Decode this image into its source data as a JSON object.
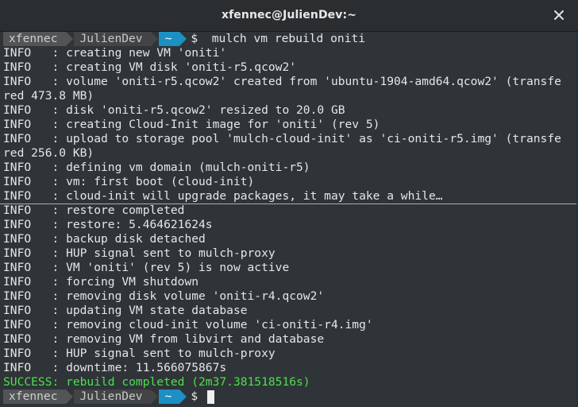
{
  "window": {
    "title": "xfennec@JulienDev:~"
  },
  "prompt_top": {
    "user": "xfennec",
    "host": "JulienDev",
    "dir": "~",
    "symbol": "$",
    "command": "  mulch vm rebuild oniti"
  },
  "output_upper": [
    "INFO   : creating new VM 'oniti'",
    "INFO   : creating VM disk 'oniti-r5.qcow2'",
    "INFO   : volume 'oniti-r5.qcow2' created from 'ubuntu-1904-amd64.qcow2' (transfe",
    "red 473.8 MB)",
    "INFO   : disk 'oniti-r5.qcow2' resized to 20.0 GB",
    "INFO   : creating Cloud-Init image for 'oniti' (rev 5)",
    "INFO   : upload to storage pool 'mulch-cloud-init' as 'ci-oniti-r5.img' (transfe",
    "red 256.0 KB)",
    "INFO   : defining vm domain (mulch-oniti-r5)",
    "INFO   : vm: first boot (cloud-init)",
    "INFO   : cloud-init will upgrade packages, it may take a while…"
  ],
  "output_lower": [
    "INFO   : restore completed",
    "INFO   : restore: 5.464621624s",
    "INFO   : backup disk detached",
    "INFO   : HUP signal sent to mulch-proxy",
    "INFO   : VM 'oniti' (rev 5) is now active",
    "INFO   : forcing VM shutdown",
    "INFO   : removing disk volume 'oniti-r4.qcow2'",
    "INFO   : updating VM state database",
    "INFO   : removing cloud-init volume 'ci-oniti-r4.img'",
    "INFO   : removing VM from libvirt and database",
    "INFO   : HUP signal sent to mulch-proxy",
    "INFO   : downtime: 11.566075867s"
  ],
  "success_line": "SUCCESS: rebuild completed (2m37.381518516s)",
  "prompt_bottom": {
    "user": "xfennec",
    "host": "JulienDev",
    "dir": "~",
    "symbol": "$"
  },
  "icons": {
    "close": "close-icon"
  },
  "colors": {
    "prompt_dir_bg": "#1c8fc3",
    "success_text": "#4be14b",
    "terminal_bg": "#2f3438"
  }
}
